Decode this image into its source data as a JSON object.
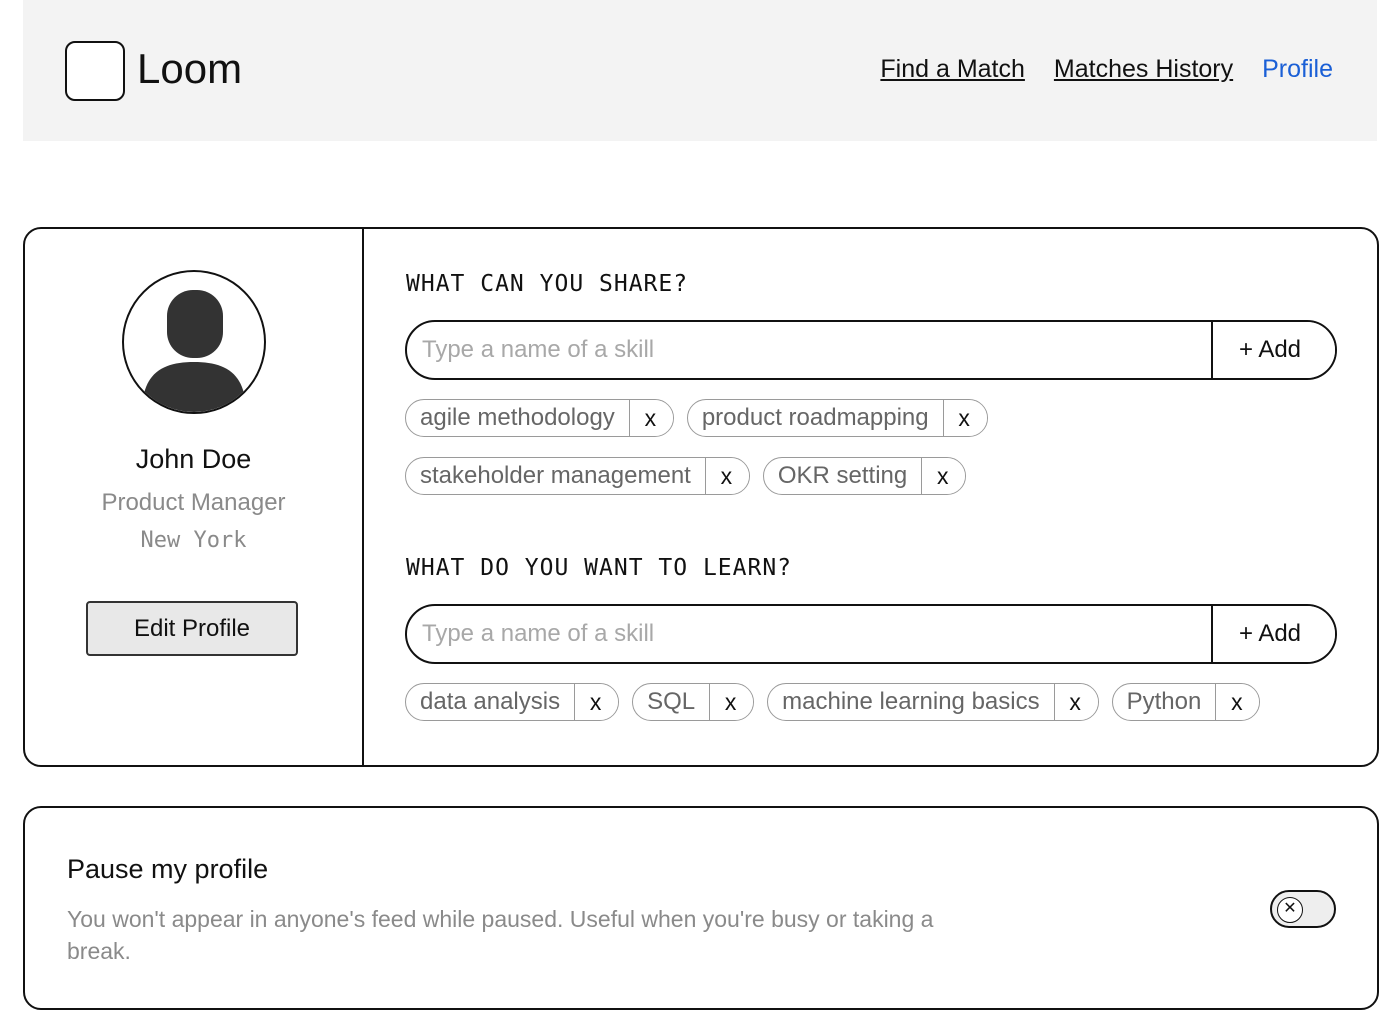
{
  "header": {
    "brand": "Loom",
    "nav": [
      {
        "label": "Find a Match",
        "active": false
      },
      {
        "label": "Matches History",
        "active": false
      },
      {
        "label": "Profile",
        "active": true
      }
    ]
  },
  "profile": {
    "name": "John Doe",
    "role": "Product Manager",
    "city": "New York",
    "edit_label": "Edit Profile"
  },
  "share": {
    "title": "WHAT CAN YOU SHARE?",
    "placeholder": "Type a name of a skill",
    "add_label": "+ Add",
    "remove_label": "x",
    "tags": [
      "agile methodology",
      "product roadmapping",
      "stakeholder management",
      "OKR setting"
    ]
  },
  "learn": {
    "title": "WHAT DO YOU WANT TO LEARN?",
    "placeholder": "Type a name of a skill",
    "add_label": "+ Add",
    "remove_label": "x",
    "tags": [
      "data analysis",
      "SQL",
      "machine learning basics",
      "Python"
    ]
  },
  "pause": {
    "title": "Pause my profile",
    "description": "You won't appear in anyone's feed while paused. Useful when you're busy or taking a break.",
    "toggle_icon": "x-circle-icon",
    "enabled": false
  },
  "colors": {
    "accent": "#1a5fd6",
    "header_bg": "#f3f3f3",
    "muted_text": "#8a8a8a"
  }
}
